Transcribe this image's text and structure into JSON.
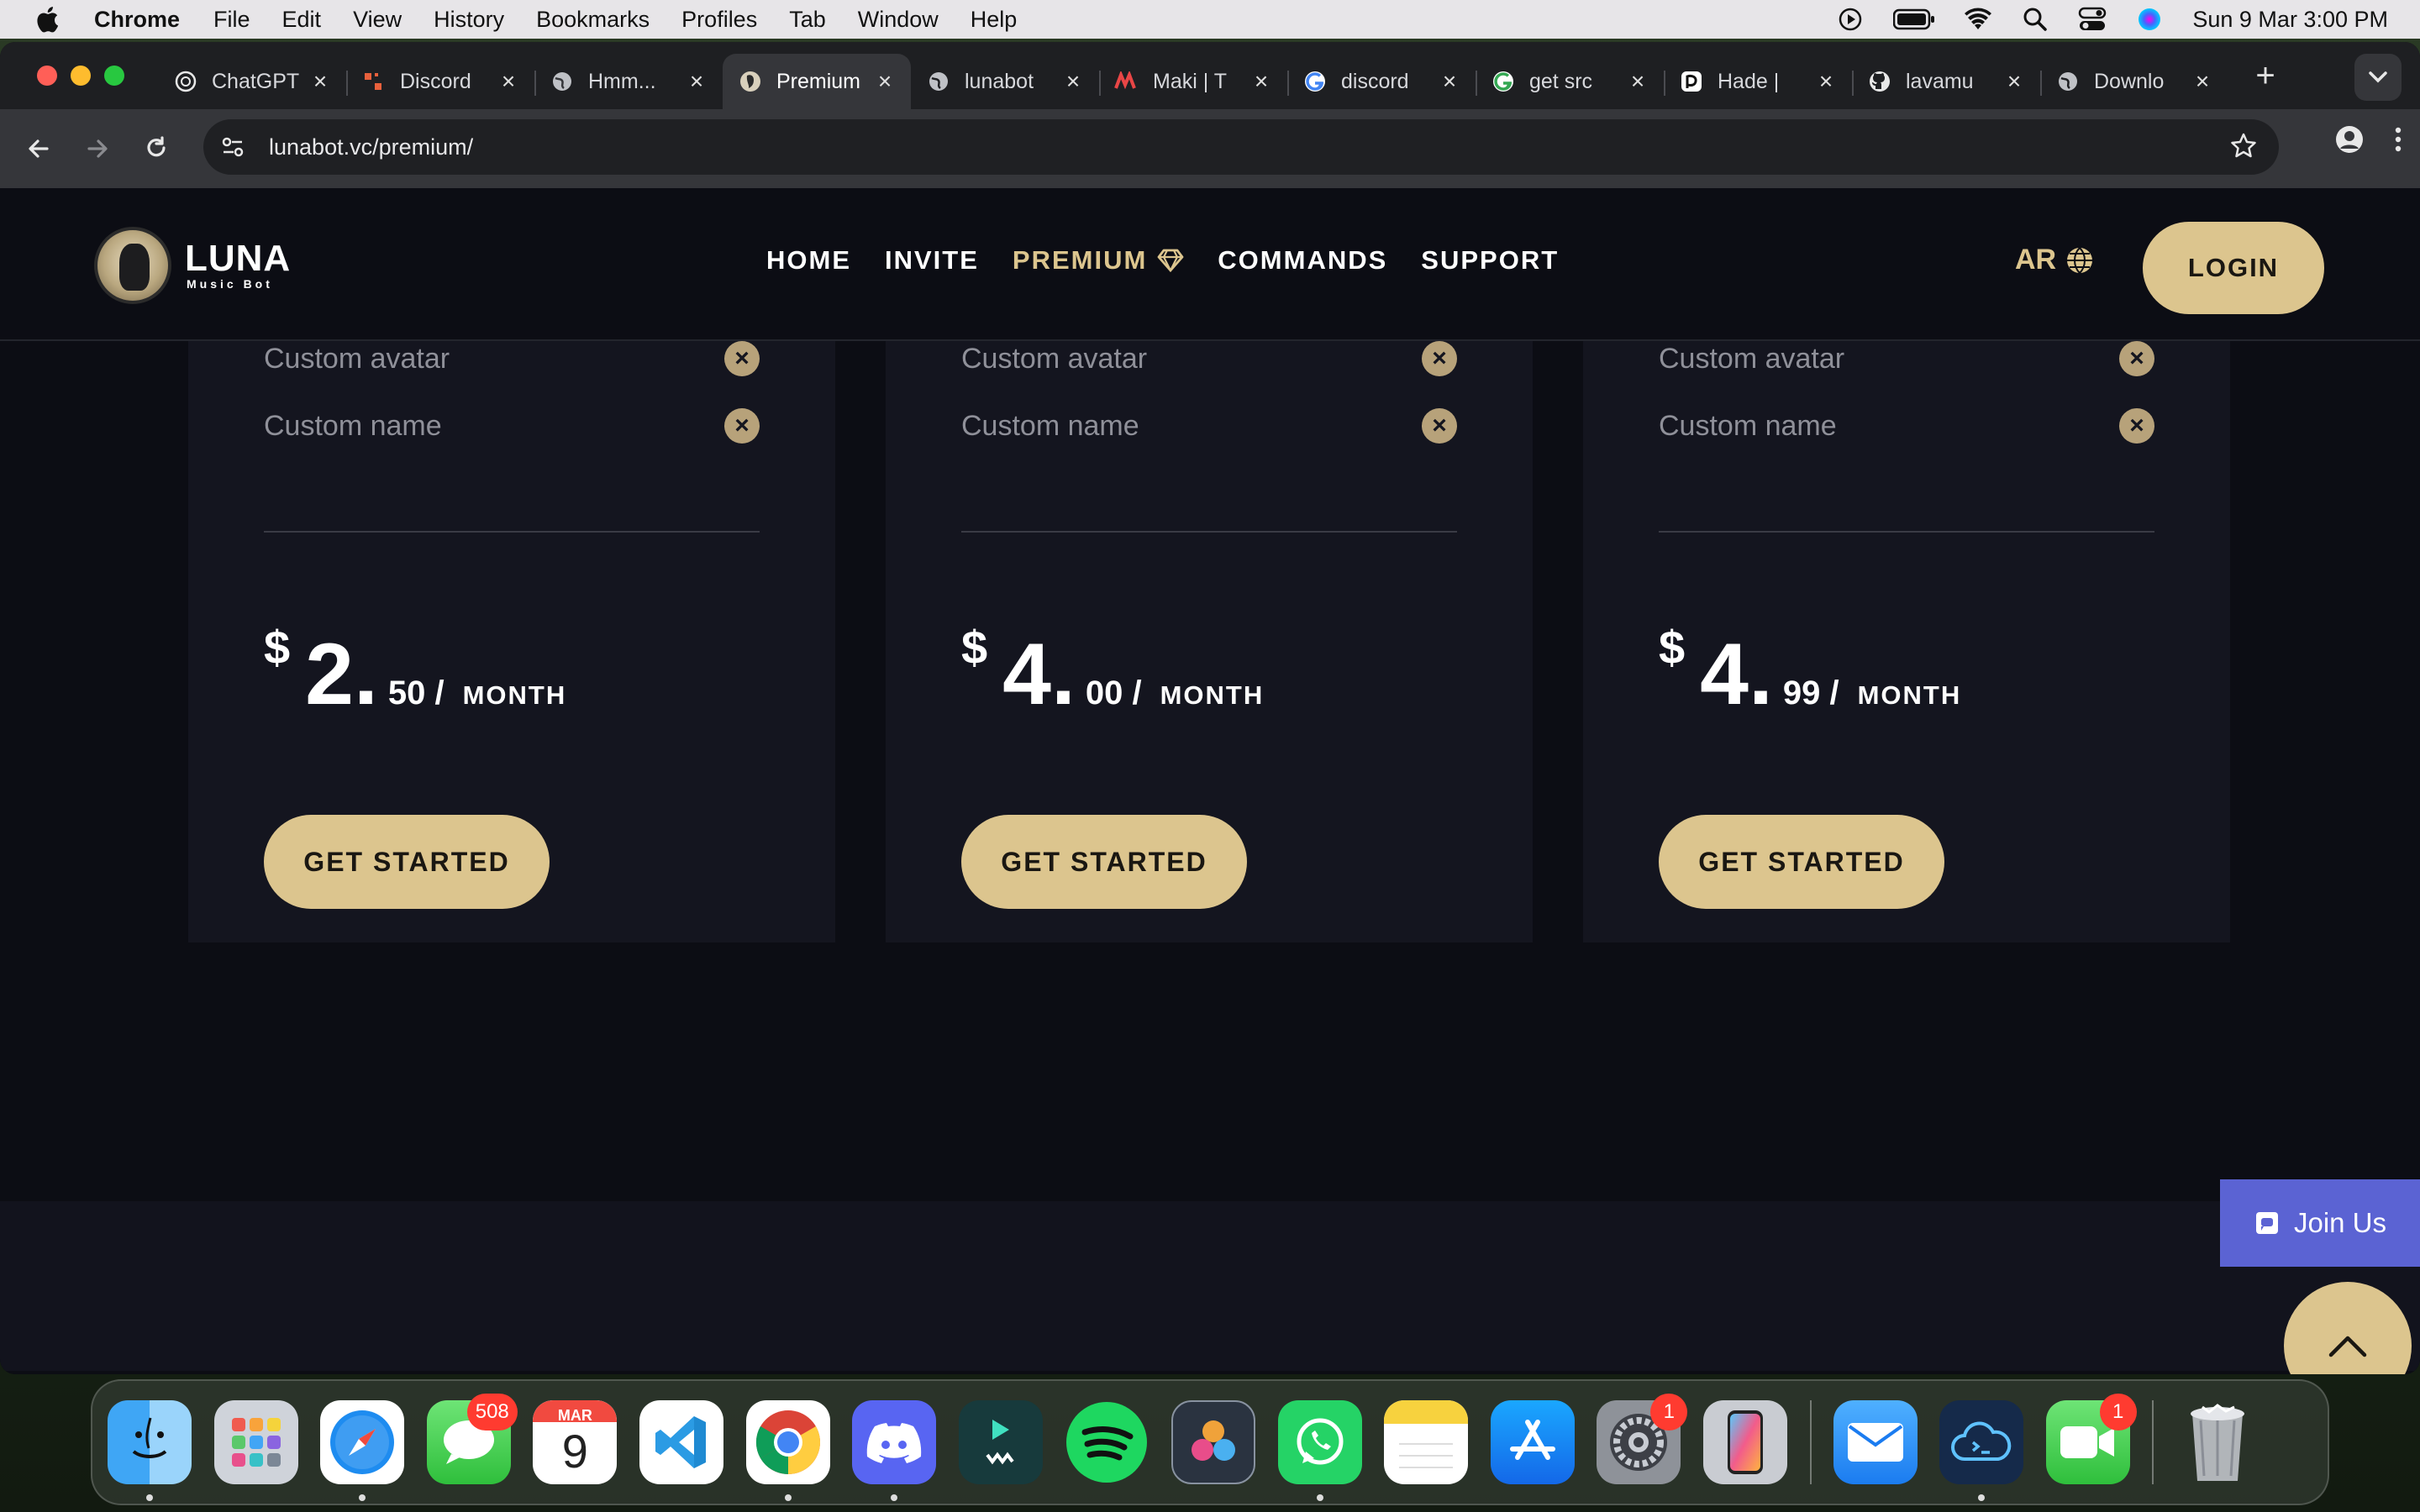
{
  "menubar": {
    "app_name": "Chrome",
    "items": [
      "File",
      "Edit",
      "View",
      "History",
      "Bookmarks",
      "Profiles",
      "Tab",
      "Window",
      "Help"
    ],
    "clock": "Sun 9 Mar  3:00 PM"
  },
  "browser": {
    "tabs": [
      {
        "title": "ChatGPT",
        "icon": "chatgpt-icon"
      },
      {
        "title": "Discord",
        "icon": "discord-icon"
      },
      {
        "title": "Hmm...",
        "icon": "globe-icon"
      },
      {
        "title": "Premium",
        "icon": "luna-icon",
        "active": true
      },
      {
        "title": "lunabot",
        "icon": "globe-icon"
      },
      {
        "title": "Maki | T",
        "icon": "maki-icon"
      },
      {
        "title": "discord",
        "icon": "google-icon"
      },
      {
        "title": "get src",
        "icon": "google-icon"
      },
      {
        "title": "Hade | ",
        "icon": "hade-icon"
      },
      {
        "title": "lavamu",
        "icon": "github-icon"
      },
      {
        "title": "Downlo",
        "icon": "globe-icon"
      }
    ],
    "url": "lunabot.vc/premium/"
  },
  "site": {
    "logo": {
      "brand": "LUNA",
      "sub": "Music Bot"
    },
    "nav": [
      "HOME",
      "INVITE",
      "PREMIUM",
      "COMMANDS",
      "SUPPORT"
    ],
    "lang": "AR",
    "login": "LOGIN",
    "plans": [
      {
        "features": [
          "Custom avatar",
          "Custom name"
        ],
        "currency": "$",
        "whole": "2.",
        "fraction": "50 /",
        "period": "MONTH",
        "cta": "GET STARTED"
      },
      {
        "features": [
          "Custom avatar",
          "Custom name"
        ],
        "currency": "$",
        "whole": "4.",
        "fraction": "00 /",
        "period": "MONTH",
        "cta": "GET STARTED"
      },
      {
        "features": [
          "Custom avatar",
          "Custom name"
        ],
        "currency": "$",
        "whole": "4.",
        "fraction": "99 /",
        "period": "MONTH",
        "cta": "GET STARTED"
      }
    ],
    "join_us": "Join Us",
    "colors": {
      "accent": "#dcc58e",
      "join": "#5b63d3",
      "bg": "#0c0d14",
      "card": "#14151f"
    }
  },
  "dock": {
    "apps": [
      {
        "name": "Finder",
        "icon": "finder-icon",
        "running": true
      },
      {
        "name": "Launchpad",
        "icon": "launchpad-icon"
      },
      {
        "name": "Safari",
        "icon": "safari-icon",
        "running": true
      },
      {
        "name": "Messages",
        "icon": "messages-icon",
        "badge": "508"
      },
      {
        "name": "Calendar",
        "icon": "calendar-icon",
        "month": "MAR",
        "day": "9"
      },
      {
        "name": "VS Code",
        "icon": "vscode-icon"
      },
      {
        "name": "Chrome",
        "icon": "chrome-icon",
        "running": true
      },
      {
        "name": "Discord",
        "icon": "discord-icon",
        "running": true
      },
      {
        "name": "Filmora",
        "icon": "filmora-icon"
      },
      {
        "name": "Spotify",
        "icon": "spotify-icon"
      },
      {
        "name": "DaVinci Resolve",
        "icon": "davinci-icon"
      },
      {
        "name": "WhatsApp",
        "icon": "whatsapp-icon",
        "running": true
      },
      {
        "name": "Notes",
        "icon": "notes-icon"
      },
      {
        "name": "App Store",
        "icon": "appstore-icon"
      },
      {
        "name": "System Settings",
        "icon": "settings-icon",
        "badge": "1"
      },
      {
        "name": "iPhone Mirroring",
        "icon": "iphone-icon"
      },
      {
        "name": "Mail",
        "icon": "mail-icon"
      },
      {
        "name": "Terminal Cloud",
        "icon": "cloud-terminal-icon",
        "running": true
      },
      {
        "name": "FaceTime",
        "icon": "facetime-icon",
        "badge": "1"
      },
      {
        "name": "Trash",
        "icon": "trash-icon"
      }
    ]
  }
}
